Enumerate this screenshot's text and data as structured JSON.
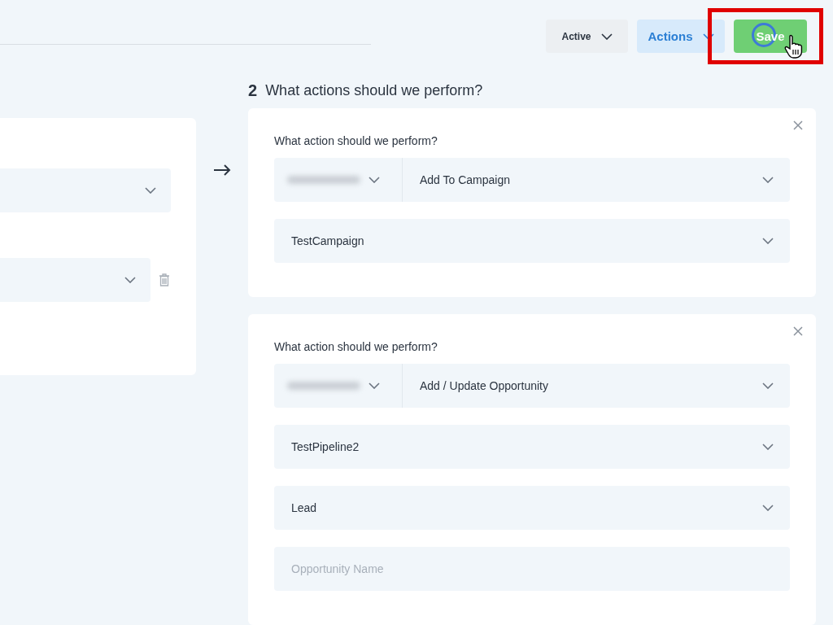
{
  "toolbar": {
    "status": {
      "label": "Active"
    },
    "actions": {
      "label": "Actions"
    },
    "save": {
      "label": "Save",
      "loading": true,
      "highlighted": true
    }
  },
  "trigger_card": {
    "selects": [
      {
        "removable": false
      },
      {
        "removable": true
      }
    ]
  },
  "actions_section": {
    "step": "2",
    "title": "What actions should we perform?",
    "actions": [
      {
        "label": "What action should we perform?",
        "fields": [
          {
            "kind": "split",
            "value": "Add To Campaign"
          },
          {
            "kind": "select",
            "value": "TestCampaign"
          }
        ]
      },
      {
        "label": "What action should we perform?",
        "fields": [
          {
            "kind": "split",
            "value": "Add / Update Opportunity"
          },
          {
            "kind": "select",
            "value": "TestPipeline2"
          },
          {
            "kind": "select",
            "value": "Lead"
          },
          {
            "kind": "input",
            "placeholder": "Opportunity Name"
          }
        ]
      }
    ]
  }
}
